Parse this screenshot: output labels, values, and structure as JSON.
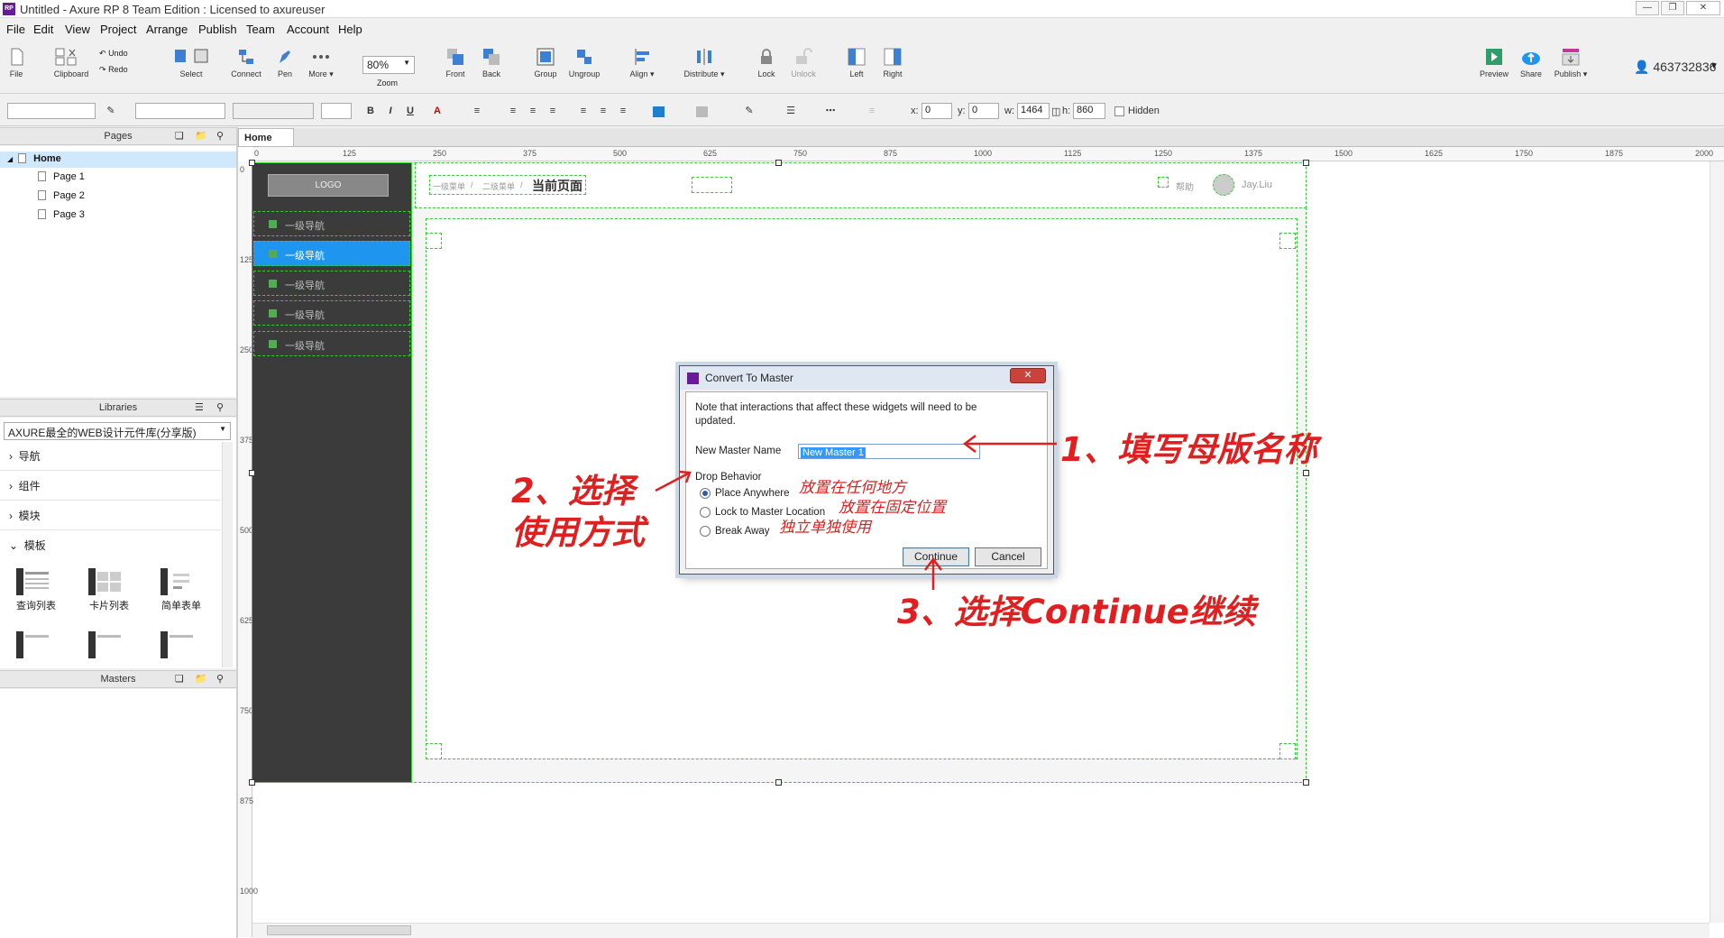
{
  "window": {
    "title": "Untitled - Axure RP 8 Team Edition : Licensed to axureuser",
    "app_logo": "RP"
  },
  "menu": [
    "File",
    "Edit",
    "View",
    "Project",
    "Arrange",
    "Publish",
    "Team",
    "Account",
    "Help"
  ],
  "toolbar": {
    "file": "File",
    "clipboard": "Clipboard",
    "undo": "Undo",
    "redo": "Redo",
    "select": "Select",
    "connect": "Connect",
    "pen": "Pen",
    "more": "More ▾",
    "zoom_value": "80%",
    "zoom": "Zoom",
    "front": "Front",
    "back": "Back",
    "group": "Group",
    "ungroup": "Ungroup",
    "align": "Align ▾",
    "distribute": "Distribute ▾",
    "lock": "Lock",
    "unlock": "Unlock",
    "left": "Left",
    "right": "Right",
    "preview": "Preview",
    "share": "Share",
    "publish": "Publish ▾",
    "user_id": "463732836"
  },
  "format": {
    "x_label": "x:",
    "x_value": "0",
    "y_label": "y:",
    "y_value": "0",
    "w_label": "w:",
    "w_value": "1464",
    "h_label": "h:",
    "h_value": "860",
    "hidden": "Hidden"
  },
  "pages_panel": {
    "title": "Pages",
    "home": "Home",
    "items": [
      "Page 1",
      "Page 2",
      "Page 3"
    ]
  },
  "libraries_panel": {
    "title": "Libraries",
    "selected_library": "AXURE最全的WEB设计元件库(分享版)",
    "categories": [
      "导航",
      "组件",
      "模块",
      "模板"
    ],
    "widgets": [
      "查询列表",
      "卡片列表",
      "简单表单"
    ]
  },
  "masters_panel": {
    "title": "Masters"
  },
  "canvas": {
    "tab": "Home",
    "ruler_h": [
      "0",
      "125",
      "250",
      "375",
      "500",
      "625",
      "750",
      "875",
      "1000",
      "1125",
      "1250",
      "1375",
      "1500",
      "1625",
      "1750",
      "1875",
      "2000"
    ],
    "ruler_v": [
      "0",
      "125",
      "250",
      "375",
      "500",
      "625",
      "750",
      "875",
      "1000"
    ],
    "logo": "LOGO",
    "nav_items": [
      "一级导航",
      "一级导航",
      "一级导航",
      "一级导航",
      "一级导航"
    ],
    "breadcrumb": [
      "一级菜单",
      "/",
      "二级菜单",
      "/"
    ],
    "current_page": "当前页面",
    "help": "帮助",
    "user": "Jay.Liu"
  },
  "dialog": {
    "title": "Convert To Master",
    "note": "Note that interactions that affect these widgets will need to be updated.",
    "name_label": "New Master Name",
    "name_value": "New Master 1",
    "drop_label": "Drop Behavior",
    "options": [
      "Place Anywhere",
      "Lock to Master Location",
      "Break Away"
    ],
    "continue": "Continue",
    "cancel": "Cancel"
  },
  "annotations": {
    "step1": "1、填写母版名称",
    "step2_line1": "2、选择",
    "step2_line2": "使用方式",
    "step3": "3、选择Continue继续",
    "opt1": "放置在任何地方",
    "opt2": "放置在固定位置",
    "opt3": "独立单独使用"
  },
  "colors": {
    "nav_active": "#1e96f0",
    "annotation": "#e02020",
    "wire_green": "#33cc33"
  }
}
